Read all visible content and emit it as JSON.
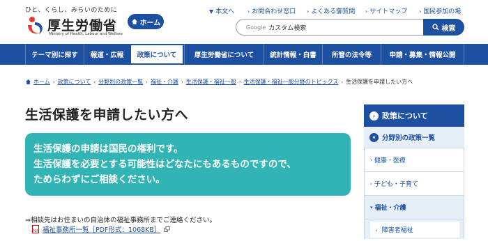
{
  "header": {
    "tagline": "ひと、くらし、みらいのために",
    "logo_name": "厚生労働省",
    "logo_en": "Ministry of Health, Labour and Welfare",
    "home_label": "ホーム"
  },
  "utility_links": [
    "本文へ",
    "お問合わせ窓口",
    "よくある御質問",
    "サイトマップ",
    "国民参加の場"
  ],
  "search": {
    "brand": "Google",
    "placeholder": "カスタム検索",
    "button_label": "検索"
  },
  "nav": [
    "テーマ別に探す",
    "報道・広報",
    "政策について",
    "厚生労働省について",
    "統計情報・白書",
    "所管の法令等",
    "申請・募集・情報公開"
  ],
  "breadcrumb": [
    "ホーム",
    "政策について",
    "分野別の政策一覧",
    "福祉・介護",
    "生活保護・福祉一般",
    "生活保護・福祉一般分野のトピックス",
    "生活保護を申請したい方へ"
  ],
  "main": {
    "title": "生活保護を申請したい方へ",
    "callout": [
      "生活保護の申請は国民の権利です。",
      "生活保護を必要とする可能性はどなたにもあるものですので、",
      "ためらわずにご相談ください。"
    ],
    "note": "⇒相談先はお住まいの自治体の福祉事務所までご連絡ください。",
    "pdf_link": "福祉事務所一覧［PDF形式：1068KB］",
    "pdf_badge": "PDF"
  },
  "sidebar": {
    "heading": "政策について",
    "sub": "分野別の政策一覧",
    "items": [
      "健康・医療",
      "子ども・子育て",
      "福祉・介護"
    ],
    "child": "障害者福祉"
  },
  "colors": {
    "primary": "#1e50a2",
    "callout": "#33b4b4"
  }
}
